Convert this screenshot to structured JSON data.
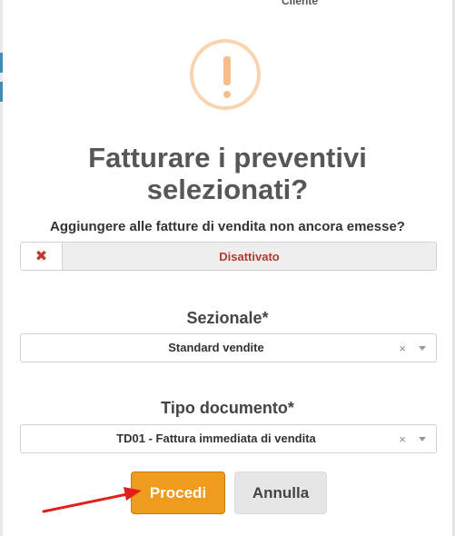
{
  "background": {
    "partial_text": "Cliente"
  },
  "dialog": {
    "icon": "exclamation-warning-icon",
    "title_line1": "Fatturare i preventivi",
    "title_line2": "selezionati?",
    "question": "Aggiungere alle fatture di vendita non ancora emesse?",
    "toggle": {
      "icon": "close-icon",
      "icon_glyph": "✖",
      "state_label": "Disattivato"
    },
    "sezionale": {
      "label": "Sezionale*",
      "value": "Standard vendite",
      "clear_glyph": "×"
    },
    "tipo_documento": {
      "label": "Tipo documento*",
      "value": "TD01 - Fattura immediata di vendita",
      "clear_glyph": "×"
    },
    "buttons": {
      "proceed": "Procedi",
      "cancel": "Annulla"
    }
  },
  "colors": {
    "primary": "#ef9b1d",
    "warning_ring": "#f8d4b0",
    "toggle_off": "#b03a2e",
    "annotation_arrow": "#e0201c"
  }
}
